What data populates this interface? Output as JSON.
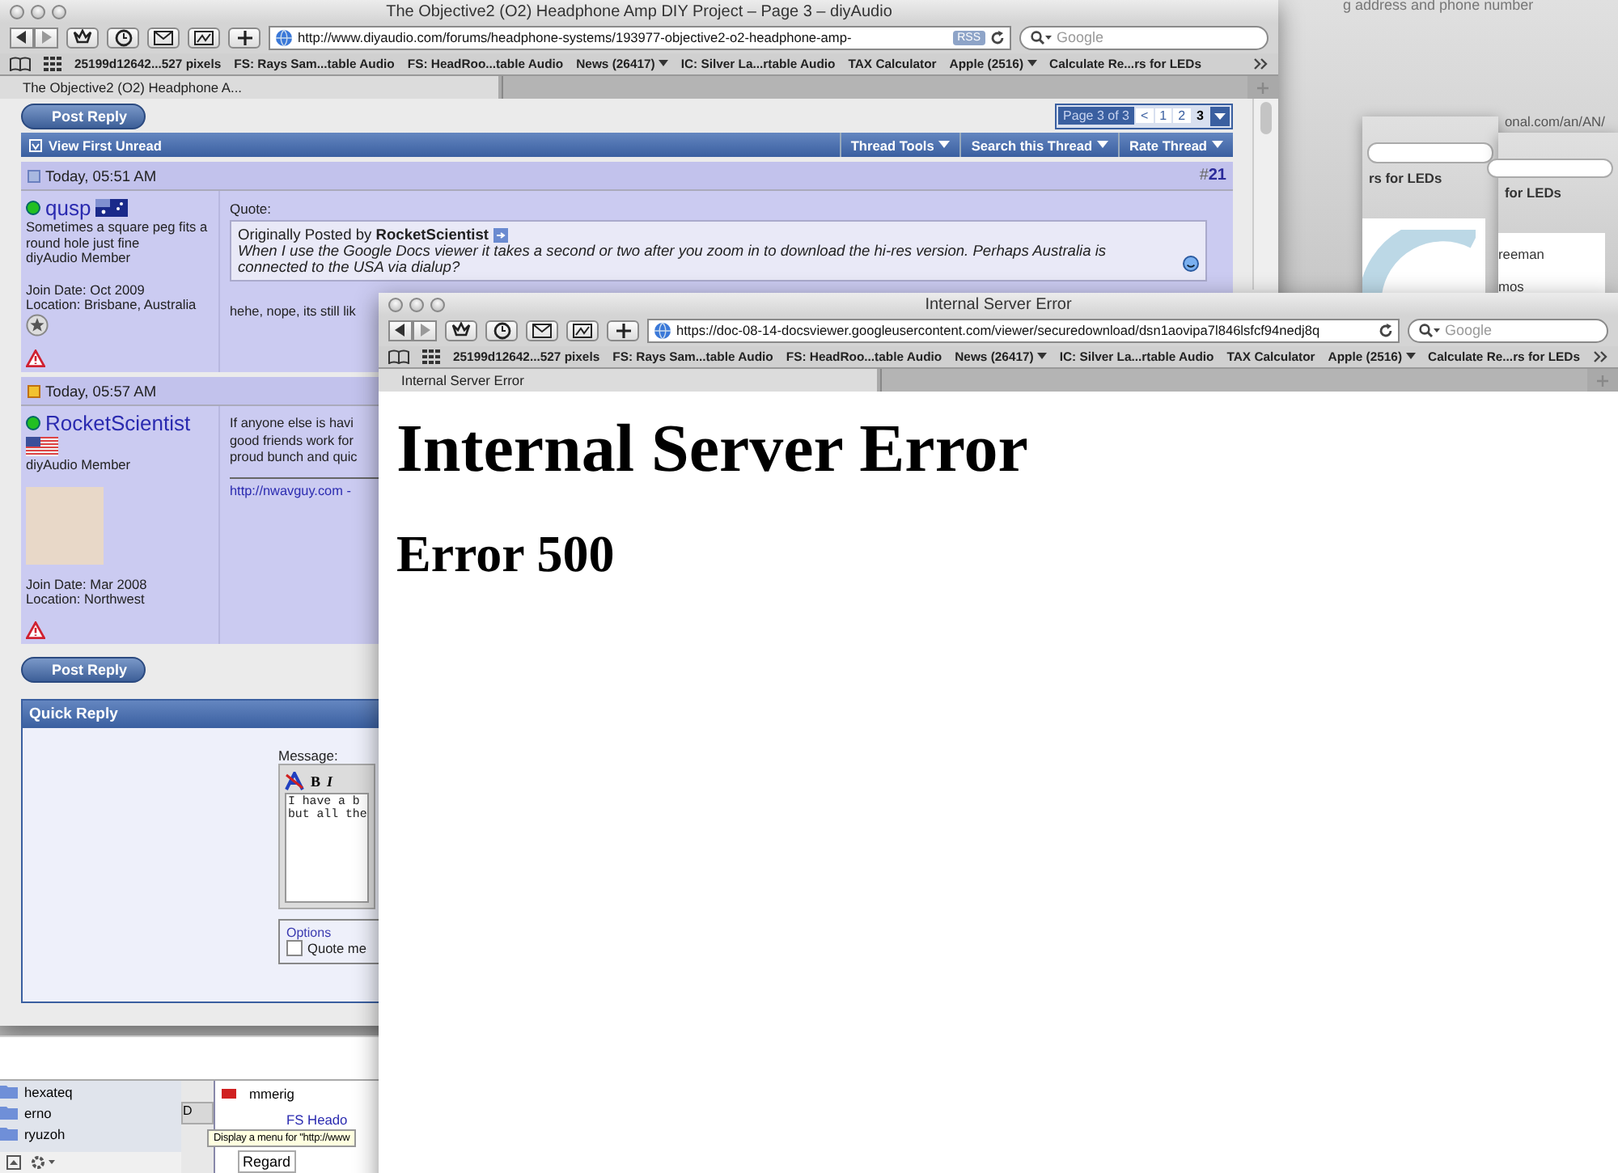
{
  "back_window": {
    "title": "The Objective2 (O2) Headphone Amp DIY Project – Page 3 – diyAudio",
    "url": "http://www.diyaudio.com/forums/headphone-systems/193977-objective2-o2-headphone-amp-",
    "rss": "RSS",
    "search_placeholder": "Google",
    "bookmarks": [
      {
        "label": "25199d12642...527 pixels",
        "menu": false
      },
      {
        "label": "FS: Rays Sam...table Audio",
        "menu": false
      },
      {
        "label": "FS: HeadRoo...table Audio",
        "menu": false
      },
      {
        "label": "News (26417)",
        "menu": true
      },
      {
        "label": "IC: Silver La...rtable Audio",
        "menu": false
      },
      {
        "label": "TAX Calculator",
        "menu": false
      },
      {
        "label": "Apple (2516)",
        "menu": true
      },
      {
        "label": "Calculate Re...rs for LEDs",
        "menu": false
      }
    ],
    "tabs": [
      {
        "label": "The Objective2 (O2) Headphone A...",
        "selected": true
      }
    ]
  },
  "forum": {
    "post_reply": "Post Reply",
    "pagination": {
      "label": "Page 3 of 3",
      "prev": "<",
      "pages": [
        {
          "label": "1",
          "selected": false
        },
        {
          "label": "2",
          "selected": false
        },
        {
          "label": "3",
          "selected": true
        }
      ]
    },
    "thread_bar": {
      "first_unread": "View First Unread",
      "menus": [
        "Thread Tools",
        "Search this Thread",
        "Rate Thread"
      ]
    },
    "posts": [
      {
        "date": "Today, 05:51 AM",
        "unread": false,
        "number": "#**21**",
        "user": "qusp",
        "online": true,
        "flag": {
          "kind": "au"
        },
        "user_title": "Sometimes a square peg fits a round hole just fine",
        "rank": "diyAudio Member",
        "avatar": false,
        "join": "Join Date: Oct 2009",
        "location": "Location: Brisbane, Australia",
        "reputation": true,
        "quote": {
          "label": "Quote:",
          "by": "Originally Posted by **RocketScientist**",
          "text": "When I use the Google Docs viewer it takes a second or two after you zoom in to download the hi-res version. Perhaps Australia is connected to the USA via dialup?"
        },
        "body_lines": [
          "hehe, nope, its still lik"
        ]
      },
      {
        "date": "Today, 05:57 AM",
        "unread": true,
        "user": "RocketScientist",
        "online": true,
        "flag": {
          "kind": "us"
        },
        "rank": "diyAudio Member",
        "avatar": true,
        "join": "Join Date: Mar 2008",
        "location": "Location: Northwest",
        "reputation": false,
        "body_lines": [
          "If anyone else is havi",
          "good friends work for",
          "proud bunch and quic"
        ],
        "link": "http://nwavguy.com -"
      }
    ],
    "post_reply_bottom": "Post Reply",
    "quick_reply": {
      "title": "Quick Reply",
      "message_label": "Message:",
      "bold": "B",
      "italic": "I",
      "text_lines": [
        "I have a b",
        "but all the"
      ],
      "options_legend": "Options",
      "quote_option": {
        "label": "Quote me",
        "checked": false
      }
    }
  },
  "front_window": {
    "title": "Internal Server Error",
    "url": "https://doc-08-14-docsviewer.googleusercontent.com/viewer/securedownload/dsn1aovipa7l846lsfcf94nedj8q",
    "search_placeholder": "Google",
    "bookmarks": [
      {
        "label": "25199d12642...527 pixels",
        "menu": false
      },
      {
        "label": "FS: Rays Sam...table Audio",
        "menu": false
      },
      {
        "label": "FS: HeadRoo...table Audio",
        "menu": false
      },
      {
        "label": "News (26417)",
        "menu": true
      },
      {
        "label": "IC: Silver La...rtable Audio",
        "menu": false
      },
      {
        "label": "TAX Calculator",
        "menu": false
      },
      {
        "label": "Apple (2516)",
        "menu": true
      },
      {
        "label": "Calculate Re...rs for LEDs",
        "menu": false
      }
    ],
    "tabs": [
      {
        "label": "Internal Server Error",
        "selected": true
      }
    ],
    "heading": "Internal Server Error",
    "subheading": "Error 500"
  },
  "background_windows": {
    "top_text": "g address and phone number",
    "url_fragment": "onal.com/an/AN/",
    "bookmark_fragments": [
      "rs for LEDs",
      "for LEDs"
    ],
    "list_fragments": [
      "reeman",
      "mos"
    ]
  },
  "finder": {
    "folders": [
      "hexateq",
      "erno",
      "ryuzoh"
    ],
    "mail_sender": "mmerig",
    "mail_subject": "FS Heado",
    "button_fragment": "D",
    "field_fragment": "Regard",
    "tooltip": "Display a menu for \"http://www"
  }
}
